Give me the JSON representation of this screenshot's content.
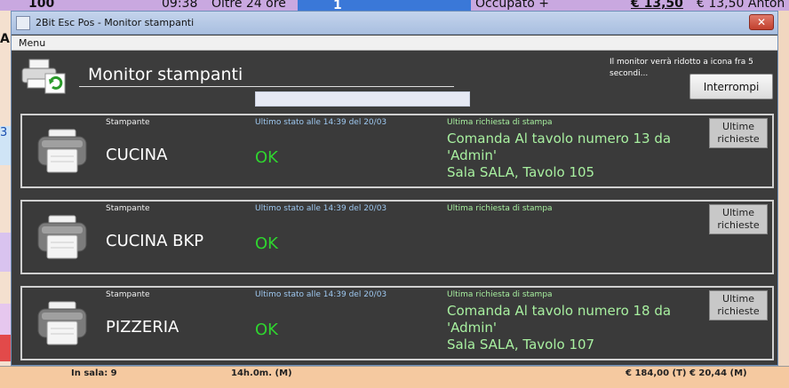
{
  "background": {
    "top_left": "100",
    "top_time": "09:38",
    "top_duration": "Oltre 24 ore",
    "top_number": "1",
    "top_status": "Occupato +",
    "top_price": "€ 13,50",
    "top_price2": "€ 13,50 Anton",
    "left_letter": "A",
    "left_digit": "3",
    "bottom_hall": "In sala: 9",
    "bottom_time": "14h.0m. (M)",
    "bottom_total": "€ 184,00 (T) € 20,44 (M)"
  },
  "window": {
    "title": "2Bit Esc Pos - Monitor stampanti",
    "close_label": "✕",
    "menu": "Menu"
  },
  "header": {
    "title": "Monitor stampanti",
    "notice": "Il monitor verrà ridotto a icona fra 5 secondi...",
    "stop_button": "Interrompi",
    "progress": 0
  },
  "labels": {
    "printer": "Stampante",
    "status": "Ultimo stato alle 14:39 del 20/03",
    "request": "Ultima richiesta di stampa",
    "recent_line1": "Ultime",
    "recent_line2": "richieste"
  },
  "printers": [
    {
      "name": "CUCINA",
      "status": "OK",
      "request_line1": "Comanda Al tavolo numero 13 da",
      "request_line2": "'Admin'",
      "request_line3": "Sala SALA, Tavolo 105"
    },
    {
      "name": "CUCINA BKP",
      "status": "OK",
      "request_line1": "",
      "request_line2": "",
      "request_line3": ""
    },
    {
      "name": "PIZZERIA",
      "status": "OK",
      "request_line1": "Comanda Al tavolo numero 18 da",
      "request_line2": "'Admin'",
      "request_line3": "Sala SALA, Tavolo 107"
    }
  ],
  "colors": {
    "window_bg": "#3c3c3c",
    "status_ok": "#2fd42f",
    "status_label": "#9ec8f0",
    "request_text": "#a8f0a0"
  },
  "icons": {
    "title_icon": "app-icon",
    "header_icon": "printer-refresh-icon",
    "card_icon": "printer-icon"
  }
}
